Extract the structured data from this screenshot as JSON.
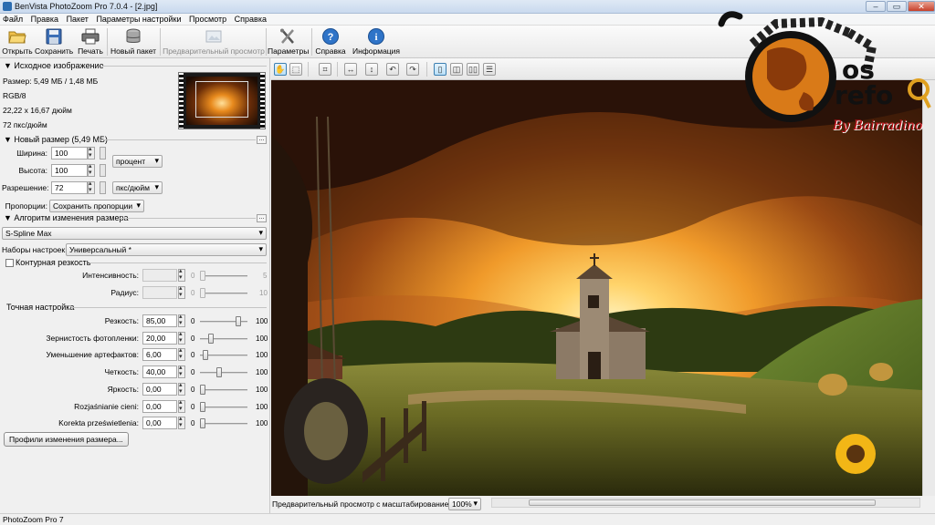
{
  "window": {
    "title": "BenVista PhotoZoom Pro 7.0.4 - [2.jpg]",
    "controls": [
      "–",
      "▭",
      "✕"
    ]
  },
  "menu": [
    "Файл",
    "Правка",
    "Пакет",
    "Параметры настройки",
    "Просмотр",
    "Справка"
  ],
  "toolbar": {
    "open": "Открыть",
    "save": "Сохранить",
    "print": "Печать",
    "new_batch": "Новый пакет",
    "preview": "Предварительный просмотр",
    "params": "Параметры",
    "help": "Справка",
    "info": "Информация"
  },
  "source": {
    "header": "Исходное изображение",
    "size": "Размер: 5,49 МБ / 1,48 МБ",
    "mode": "RGB/8",
    "dims": "22,22 x 16,67 дюйм",
    "res": "72 пкс/дюйм"
  },
  "newsize": {
    "header": "Новый размер (5,49 МБ)",
    "width_label": "Ширина:",
    "width_value": "100",
    "height_label": "Высота:",
    "height_value": "100",
    "unit": "процент",
    "res_label": "Разрешение:",
    "res_value": "72",
    "res_unit": "пкс/дюйм",
    "prop_label": "Пропорции:",
    "prop_value": "Сохранить пропорции",
    "dots": "..."
  },
  "algorithm": {
    "header": "Алгоритм изменения размера",
    "method": "S-Spline Max",
    "presets_label": "Наборы настроек:",
    "presets_value": "Универсальный *",
    "dots": "..."
  },
  "contour": {
    "header": "Контурная резкость",
    "rows": [
      {
        "label": "Интенсивность:",
        "value": "",
        "min": "0",
        "max": "5",
        "level": 0.0
      },
      {
        "label": "Радиус:",
        "value": "",
        "min": "0",
        "max": "10",
        "level": 0.0
      }
    ]
  },
  "fine": {
    "header": "Точная настройка",
    "rows": [
      {
        "label": "Резкость:",
        "value": "85,00",
        "min": "0",
        "max": "100",
        "level": 0.85
      },
      {
        "label": "Зернистость фотопленки:",
        "value": "20,00",
        "min": "0",
        "max": "100",
        "level": 0.2
      },
      {
        "label": "Уменьшение артефактов:",
        "value": "6,00",
        "min": "0",
        "max": "100",
        "level": 0.06
      },
      {
        "label": "Четкость:",
        "value": "40,00",
        "min": "0",
        "max": "100",
        "level": 0.4
      },
      {
        "label": "Яркость:",
        "value": "0,00",
        "min": "0",
        "max": "100",
        "level": 0.0
      },
      {
        "label": "Rozjaśnianie cieni:",
        "value": "0,00",
        "min": "0",
        "max": "100",
        "level": 0.0
      },
      {
        "label": "Korekta prześwietlenia:",
        "value": "0,00",
        "min": "0",
        "max": "100",
        "level": 0.0
      }
    ]
  },
  "profiles_button": "Профили изменения размера...",
  "preview_bar": {
    "label": "Предварительный просмотр с масштабированием:",
    "zoom": "100%"
  },
  "statusbar": "PhotoZoom Pro 7",
  "watermark": {
    "text1": "os",
    "text2": "refo",
    "signature": "By Bairradino"
  },
  "colors": {
    "accent": "#2b6cb0",
    "watermark_red": "#c8131c"
  }
}
